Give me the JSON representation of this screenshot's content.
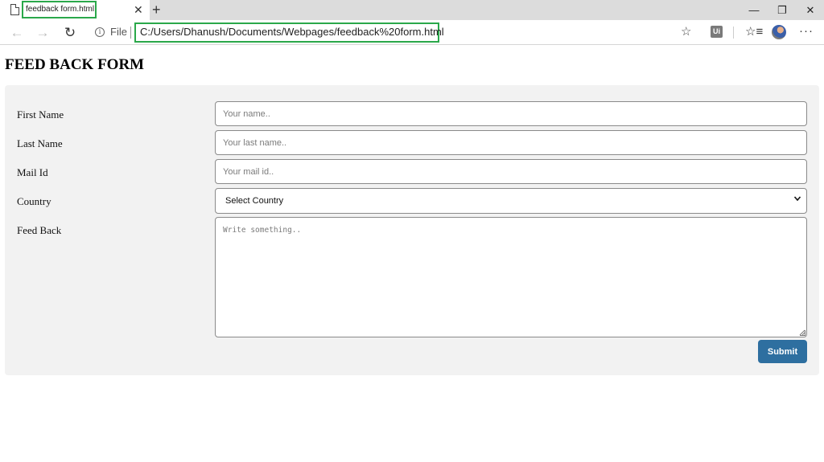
{
  "browser": {
    "tab": {
      "title": "feedback form.html",
      "close_glyph": "✕",
      "icon": "document-icon"
    },
    "new_tab_glyph": "+",
    "window": {
      "minimize": "—",
      "restore": "❐",
      "close": "✕"
    },
    "nav": {
      "back": "←",
      "forward": "→",
      "refresh": "↻"
    },
    "address": {
      "info_glyph": "i",
      "scheme_label": "File",
      "url": "C:/Users/Dhanush/Documents/Webpages/feedback%20form.html"
    },
    "toolbar": {
      "star": "☆",
      "extension": "Ui",
      "favorites": "☆≡",
      "more": "···"
    },
    "highlight_color": "#2aa84a"
  },
  "page": {
    "title": "FEED BACK FORM",
    "form": {
      "first_name": {
        "label": "First Name",
        "placeholder": "Your name.."
      },
      "last_name": {
        "label": "Last Name",
        "placeholder": "Your last name.."
      },
      "mail": {
        "label": "Mail Id",
        "placeholder": "Your mail id.."
      },
      "country": {
        "label": "Country",
        "selected": "Select Country"
      },
      "feedback": {
        "label": "Feed Back",
        "placeholder": "Write something.."
      },
      "submit_label": "Submit",
      "submit_color": "#2e6fa0"
    }
  }
}
